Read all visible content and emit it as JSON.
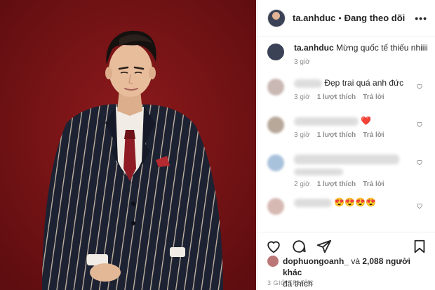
{
  "post": {
    "username": "ta.anhduc",
    "separator": "•",
    "follow_label": "Đang theo dõi",
    "more_label": "•••"
  },
  "caption": {
    "username": "ta.anhduc",
    "text": "Mừng quốc tế thiếu nhiiii",
    "time": "3 giờ"
  },
  "comments": [
    {
      "text": "Đẹp trai quá anh đức",
      "time": "3 giờ",
      "likes": "1 lượt thích",
      "reply": "Trả lời"
    },
    {
      "text": "❤️",
      "time": "3 giờ",
      "likes": "1 lượt thích",
      "reply": "Trả lời"
    },
    {
      "text": "",
      "time": "2 giờ",
      "likes": "1 lượt thích",
      "reply": "Trả lời"
    },
    {
      "text": "😍😍😍😍",
      "time": "",
      "likes": "",
      "reply": ""
    }
  ],
  "likes": {
    "user": "dophuongoanh_",
    "connector": "và",
    "count": "2,088 người khác",
    "suffix": "đã thích"
  },
  "timestamp": "3 GIỜ TRƯỚC"
}
